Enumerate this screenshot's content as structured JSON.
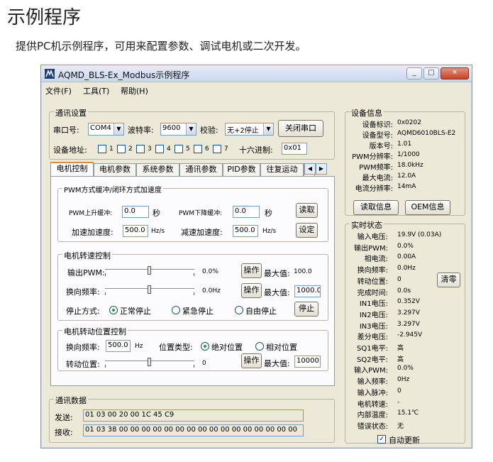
{
  "doc": {
    "title": "示例程序",
    "subtitle": "提供PC机示例程序，可用来配置参数、调试电机或二次开发。"
  },
  "window": {
    "title": "AQMD_BLS-Ex_Modbus示例程序",
    "controls": {
      "minimize": "_",
      "maximize": "□",
      "close": "✕"
    }
  },
  "menu": {
    "file": "文件(F)",
    "tools": "工具(T)",
    "help": "帮助(H)"
  },
  "comm": {
    "group_title": "通讯设置",
    "port_label": "串口号:",
    "port_value": "COM4",
    "baud_label": "波特率:",
    "baud_value": "9600",
    "parity_label": "校验:",
    "parity_value": "无+2停止",
    "close_port_btn": "关闭串口",
    "addr_label": "设备地址:",
    "addr_bits": [
      "1",
      "2",
      "3",
      "4",
      "5",
      "6",
      "7"
    ],
    "hex_label": "十六进制:",
    "hex_value": "0x01"
  },
  "tabs": [
    "电机控制",
    "电机参数",
    "系统参数",
    "通讯参数",
    "PID参数",
    "往复运动",
    "安"
  ],
  "pwm_mode": {
    "group_title": "PWM方式缓冲/闭环方式加速度",
    "rise_label": "PWM上升缓冲:",
    "rise_value": "0.0",
    "rise_unit": "秒",
    "fall_label": "PWM下降缓冲:",
    "fall_value": "0.0",
    "fall_unit": "秒",
    "read_btn": "读取",
    "accel_label": "加速加速度:",
    "accel_value": "500.0",
    "accel_unit": "Hz/s",
    "decel_label": "减速加速度:",
    "decel_value": "500.0",
    "decel_unit": "Hz/s",
    "set_btn": "设定"
  },
  "speed": {
    "group_title": "电机转速控制",
    "pwm_label": "输出PWM:",
    "pwm_value": "0.0%",
    "pwm_op_btn": "操作",
    "pwm_max_label": "最大值:",
    "pwm_max_value": "100.0",
    "freq_label": "换向频率:",
    "freq_value": "0.0Hz",
    "freq_op_btn": "操作",
    "freq_max_label": "最大值:",
    "freq_max_value": "1000.0",
    "stop_label": "停止方式:",
    "stop_normal": "正常停止",
    "stop_emergency": "紧急停止",
    "stop_free": "自由停止",
    "stop_btn": "停止"
  },
  "position": {
    "group_title": "电机转动位置控制",
    "freq_label": "换向频率:",
    "freq_value": "500.0",
    "freq_unit": "Hz",
    "type_label": "位置类型:",
    "type_abs": "绝对位置",
    "type_rel": "相对位置",
    "pos_label": "转动位置:",
    "pos_value": "0",
    "op_btn": "操作",
    "max_label": "最大值:",
    "max_value": "10000"
  },
  "device": {
    "group_title": "设备信息",
    "rows": [
      {
        "label": "设备标识:",
        "value": "0x0202"
      },
      {
        "label": "设备型号:",
        "value": "AQMD6010BLS-E2"
      },
      {
        "label": "版本号:",
        "value": "1.01"
      },
      {
        "label": "PWM分辨率:",
        "value": "1/1000"
      },
      {
        "label": "PWM频率:",
        "value": "18.0kHz"
      },
      {
        "label": "最大电流:",
        "value": "12.0A"
      },
      {
        "label": "电流分辨率:",
        "value": "14mA"
      }
    ],
    "read_btn": "读取信息",
    "oem_btn": "OEM信息"
  },
  "status": {
    "group_title": "实时状态",
    "rows": [
      {
        "label": "输入电压:",
        "value": "19.9V (0.03A)"
      },
      {
        "label": "输出PWM:",
        "value": "0.0%"
      },
      {
        "label": "相电流:",
        "value": "0.00A"
      },
      {
        "label": "换向频率:",
        "value": "0.0Hz"
      },
      {
        "label": "转动位置:",
        "value": "0"
      },
      {
        "label": "完成时间:",
        "value": "0.0s"
      },
      {
        "label": "IN1电压:",
        "value": "0.352V"
      },
      {
        "label": "IN2电压:",
        "value": "3.297V"
      },
      {
        "label": "IN3电压:",
        "value": "3.297V"
      },
      {
        "label": "差分电压:",
        "value": "-2.945V"
      },
      {
        "label": "SQ1电平:",
        "value": "高"
      },
      {
        "label": "SQ2电平:",
        "value": "高"
      },
      {
        "label": "输入PWM:",
        "value": "0.0%"
      },
      {
        "label": "输入频率:",
        "value": "0Hz"
      },
      {
        "label": "输入脉冲:",
        "value": "0"
      },
      {
        "label": "电机转速:",
        "value": "-"
      },
      {
        "label": "内部温度:",
        "value": "15.1℃"
      },
      {
        "label": "错误状态:",
        "value": "无"
      }
    ],
    "clear_btn": "清零",
    "auto_update_label": "自动更新",
    "auto_update_checked": "✓"
  },
  "comm_data": {
    "group_title": "通讯数据",
    "send_label": "发送:",
    "send_value": "01 03 00 20 00 1C 45 C9",
    "recv_label": "接收:",
    "recv_value": "01 03 38 00 00 00 00 00 00 00 00 00 00 00 00 00 00 00 00"
  }
}
